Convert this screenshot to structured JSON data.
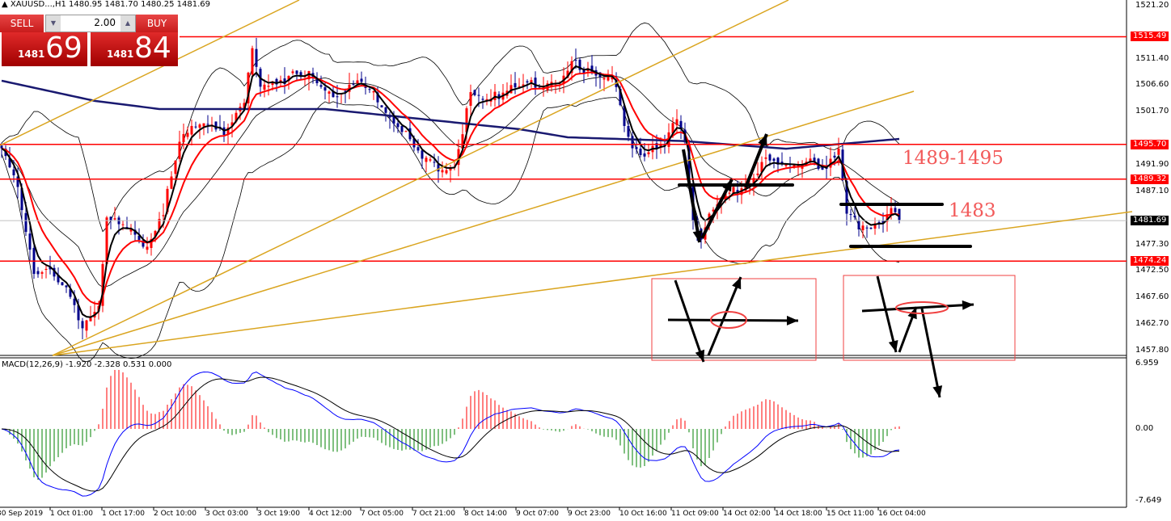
{
  "header": {
    "symbol_info": "▲ XAUUSD...,H1  1480.95 1481.70 1480.25 1481.69"
  },
  "trade_panel": {
    "sell_label": "SELL",
    "buy_label": "BUY",
    "lot": "2.00",
    "sell_small": "1481",
    "sell_big": "69",
    "buy_small": "1481",
    "buy_big": "84"
  },
  "price_axis": {
    "ticks": [
      "1521.20",
      "1511.40",
      "1506.60",
      "1501.70",
      "1491.90",
      "1487.10",
      "1477.30",
      "1472.50",
      "1467.60",
      "1462.70",
      "1457.80"
    ],
    "tags": [
      {
        "label": "1515.49",
        "price": 1515.49,
        "color": "#ff0000"
      },
      {
        "label": "1495.70",
        "price": 1495.7,
        "color": "#ff0000"
      },
      {
        "label": "1489.32",
        "price": 1489.32,
        "color": "#ff0000"
      },
      {
        "label": "1474.24",
        "price": 1474.24,
        "color": "#ff0000"
      },
      {
        "label": "1481.69",
        "price": 1481.69,
        "color": "#000000"
      }
    ]
  },
  "macd": {
    "label": "MACD(12,26,9) -1.920 -2.328 0.531 0.000",
    "ticks": [
      "6.959",
      "0.00",
      "-7.649"
    ],
    "max": 6.959,
    "min": -7.649
  },
  "time_axis": [
    "30 Sep 2019",
    "1 Oct 01:00",
    "1 Oct 17:00",
    "2 Oct 10:00",
    "3 Oct 03:00",
    "3 Oct 19:00",
    "4 Oct 12:00",
    "7 Oct 05:00",
    "7 Oct 21:00",
    "8 Oct 14:00",
    "9 Oct 07:00",
    "9 Oct 23:00",
    "10 Oct 16:00",
    "11 Oct 09:00",
    "14 Oct 02:00",
    "14 Oct 18:00",
    "15 Oct 11:00",
    "16 Oct 04:00"
  ],
  "annotations": {
    "zone_label": "1489-1495",
    "level_label": "1483"
  },
  "colors": {
    "level": "#ff0000",
    "trend": "#daa520",
    "bull": "#ff0000",
    "bear": "#00008b",
    "ma_fast": "#000000",
    "ma_slow": "#ff0000",
    "ma_long": "#191970",
    "hist_pos": "#ff0000",
    "hist_neg": "#008000"
  },
  "chart_data": {
    "type": "candlestick",
    "title": "XAUUSD H1",
    "ylim": [
      1457.8,
      1521.2
    ],
    "close_path": [
      [
        0,
        1494
      ],
      [
        4,
        1488
      ],
      [
        8,
        1473
      ],
      [
        12,
        1471.7
      ],
      [
        16,
        1468.8
      ],
      [
        20,
        1462.8
      ],
      [
        24,
        1467
      ],
      [
        26,
        1482
      ],
      [
        30,
        1480
      ],
      [
        36,
        1477.7
      ],
      [
        40,
        1483.6
      ],
      [
        44,
        1495.5
      ],
      [
        48,
        1500
      ],
      [
        52,
        1500
      ],
      [
        56,
        1498
      ],
      [
        60,
        1503
      ],
      [
        62,
        1513.3
      ],
      [
        64,
        1507.4
      ],
      [
        68,
        1507.4
      ],
      [
        72,
        1508
      ],
      [
        76,
        1508
      ],
      [
        80,
        1505.9
      ],
      [
        84,
        1505.2
      ],
      [
        88,
        1506.6
      ],
      [
        92,
        1504.4
      ],
      [
        96,
        1501.5
      ],
      [
        100,
        1497
      ],
      [
        104,
        1492.6
      ],
      [
        108,
        1491.1
      ],
      [
        112,
        1492.6
      ],
      [
        116,
        1504.4
      ],
      [
        120,
        1503
      ],
      [
        124,
        1505.9
      ],
      [
        128,
        1507.4
      ],
      [
        132,
        1506
      ],
      [
        136,
        1506
      ],
      [
        140,
        1510.4
      ],
      [
        142,
        1511.8
      ],
      [
        144,
        1508.9
      ],
      [
        148,
        1507.4
      ],
      [
        152,
        1507.4
      ],
      [
        154,
        1500
      ],
      [
        156,
        1495.5
      ],
      [
        160,
        1494
      ],
      [
        164,
        1495.5
      ],
      [
        167,
        1501.5
      ],
      [
        169,
        1497
      ],
      [
        171,
        1482.2
      ],
      [
        173,
        1479.2
      ],
      [
        176,
        1483.6
      ],
      [
        180,
        1486.6
      ],
      [
        184,
        1488
      ],
      [
        188,
        1492.6
      ],
      [
        192,
        1491.8
      ],
      [
        196,
        1491.8
      ],
      [
        200,
        1493.3
      ],
      [
        204,
        1491
      ],
      [
        207,
        1494
      ],
      [
        209,
        1482.2
      ],
      [
        212,
        1480.7
      ],
      [
        216,
        1481.5
      ],
      [
        220,
        1483
      ],
      [
        222,
        1481.7
      ]
    ],
    "ma_long_path": [
      [
        0,
        1507.4
      ],
      [
        23,
        1503.7
      ],
      [
        39,
        1502.2
      ],
      [
        80,
        1502.2
      ],
      [
        128,
        1498.5
      ],
      [
        140,
        1497
      ],
      [
        169,
        1496.3
      ],
      [
        194,
        1494.9
      ],
      [
        222,
        1496.7
      ]
    ],
    "levels": [
      1515.49,
      1495.7,
      1489.32,
      1474.24
    ],
    "current_price": 1481.69
  }
}
